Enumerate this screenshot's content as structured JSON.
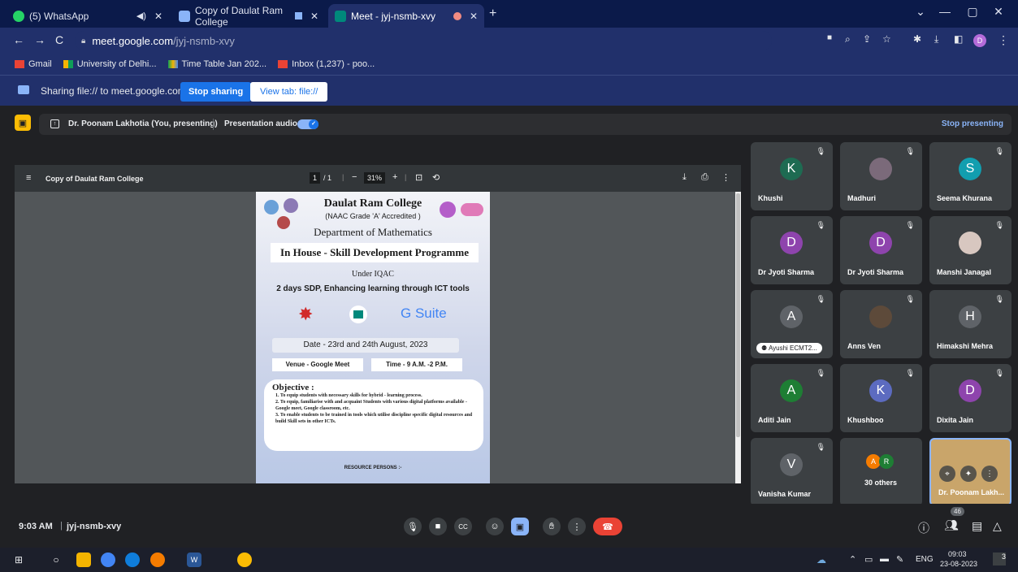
{
  "browser": {
    "tabs": [
      {
        "label": "(5) WhatsApp",
        "icon": "whatsapp-icon",
        "color": "#25d366"
      },
      {
        "label": "Copy of Daulat Ram College",
        "icon": "file-icon",
        "color": "#8ab4f8"
      },
      {
        "label": "Meet - jyj-nsmb-xvy",
        "icon": "meet-icon",
        "color": "#00897b"
      }
    ],
    "url_host": "meet.google.com",
    "url_path": "/jyj-nsmb-xvy",
    "bookmarks": [
      "Gmail",
      "University of Delhi...",
      "Time Table Jan 202...",
      "Inbox (1,237) - poo..."
    ],
    "profile_initial": "D"
  },
  "share_bar": {
    "text": "Sharing file:// to meet.google.com",
    "stop_label": "Stop sharing",
    "view_label": "View tab: file://"
  },
  "presenting": {
    "presenter": "Dr. Poonam Lakhotia (You, presenting)",
    "audio_label": "Presentation audio",
    "stop_label": "Stop presenting"
  },
  "pdf": {
    "title": "Copy of Daulat Ram College",
    "page": "1",
    "pages": "/ 1",
    "zoom": "31%",
    "content": {
      "college": "Daulat Ram College",
      "grade": "(NAAC Grade 'A' Accredited )",
      "dept": "Department of Mathematics",
      "program": "In House - Skill Development Programme",
      "under": "Under IQAC",
      "sdp": "2 days SDP, Enhancing learning through ICT tools",
      "gsuite": "G Suite",
      "date": "Date - 23rd and 24th August, 2023",
      "venue": "Venue - Google Meet",
      "time": "Time - 9 A.M. -2 P.M.",
      "objective_title": "Objective :",
      "objectives": [
        "1. To equip students with necessary skills for hybrid - learning process.",
        "2. To equip, familiarise with and acquaint Students with various digital platforms available - Google meet, Google classroom, etc.",
        "3. To enable students to be trained in tools which utilise discipline specific digital resources and build Skill sets in other ICTs."
      ],
      "resource": "RESOURCE PERSONS :-"
    }
  },
  "participants": [
    {
      "name": "Khushi",
      "initial": "K",
      "color": "#1e6b52"
    },
    {
      "name": "Madhuri",
      "initial": "",
      "color": "#7b6a7a"
    },
    {
      "name": "Seema Khurana",
      "initial": "S",
      "color": "#129eaf"
    },
    {
      "name": "Dr Jyoti Sharma",
      "initial": "D",
      "color": "#8e44ad"
    },
    {
      "name": "Dr Jyoti Sharma",
      "initial": "D",
      "color": "#8e44ad"
    },
    {
      "name": "Manshi Janagal",
      "initial": "",
      "color": "#d8c7c0"
    },
    {
      "name": "Ayushi ECMT2...",
      "initial": "A",
      "color": "#5f6368"
    },
    {
      "name": "Anns Ven",
      "initial": "",
      "color": "#5d4a3a"
    },
    {
      "name": "Himakshi Mehra",
      "initial": "H",
      "color": "#5f6368"
    },
    {
      "name": "Aditi Jain",
      "initial": "A",
      "color": "#1e7e34"
    },
    {
      "name": "Khushboo",
      "initial": "K",
      "color": "#5c6bc0"
    },
    {
      "name": "Dixita Jain",
      "initial": "D",
      "color": "#8e44ad"
    },
    {
      "name": "Vanisha Kumar",
      "initial": "V",
      "color": "#5f6368"
    },
    {
      "name": "30 others",
      "initial": "",
      "color": "#3c4043"
    },
    {
      "name": "Dr. Poonam Lakh...",
      "initial": "",
      "color": "#c9a56a"
    }
  ],
  "others_avatars": [
    "A",
    "R"
  ],
  "meeting": {
    "time": "9:03 AM",
    "code": "jyj-nsmb-xvy",
    "people_count": "46"
  },
  "taskbar": {
    "lang": "ENG",
    "time": "09:03",
    "date": "23-08-2023",
    "notif": "3"
  }
}
